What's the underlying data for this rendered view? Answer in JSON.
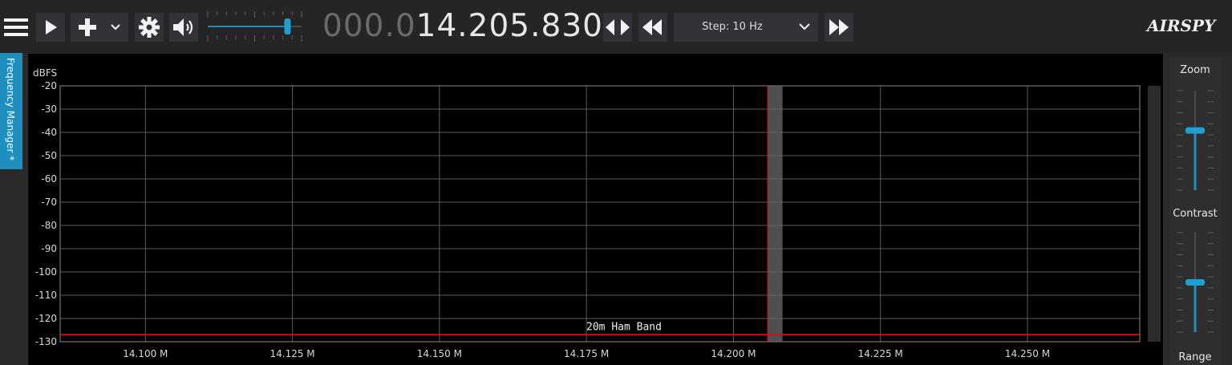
{
  "toolbar": {
    "frequency_dim": "000.0",
    "frequency_bright": "14.205.830",
    "step_label": "Step: 10 Hz",
    "volume_level": 0.85,
    "icons": [
      "menu-icon",
      "play-icon",
      "plus-icon",
      "chevron-down-icon",
      "gear-icon",
      "speaker-icon",
      "tune-arrows-icon",
      "rewind-icon",
      "fast-forward-icon"
    ]
  },
  "logo": {
    "text": "AIRSPY"
  },
  "side_tab": {
    "label": "Frequency Manager *"
  },
  "right_panel": {
    "zoom_label": "Zoom",
    "contrast_label": "Contrast",
    "range_label": "Range",
    "zoom_level": 0.4,
    "contrast_level": 0.5
  },
  "spectrum": {
    "y_unit": "dBFS",
    "band_label": "20m Ham Band",
    "tuned_frequency": 14.20583
  },
  "colors": {
    "accent": "#1f8fbf",
    "marker": "#d01010",
    "grid": "#606060"
  },
  "chart_data": {
    "type": "line",
    "ylabel": "dBFS",
    "xlim": [
      14.0855,
      14.2691
    ],
    "ylim": [
      -130,
      -20
    ],
    "grid": true,
    "y_ticks": [
      -20,
      -30,
      -40,
      -50,
      -60,
      -70,
      -80,
      -90,
      -100,
      -110,
      -120,
      -130
    ],
    "y_tick_labels": [
      "-20",
      "-30",
      "-40",
      "-50",
      "-60",
      "-70",
      "-80",
      "-90",
      "-100",
      "-110",
      "-120",
      "-130"
    ],
    "x_ticks": [
      14.1,
      14.125,
      14.15,
      14.175,
      14.2,
      14.225,
      14.25
    ],
    "x_tick_labels": [
      "14.100 M",
      "14.125 M",
      "14.150 M",
      "14.175 M",
      "14.200 M",
      "14.225 M",
      "14.250 M"
    ],
    "series": [
      {
        "x": [
          14.0855,
          14.2691
        ],
        "values": [
          -127,
          -127
        ]
      }
    ],
    "band_marker": {
      "start": 14.20583,
      "end": 14.20835,
      "label": "20m Ham Band"
    }
  }
}
